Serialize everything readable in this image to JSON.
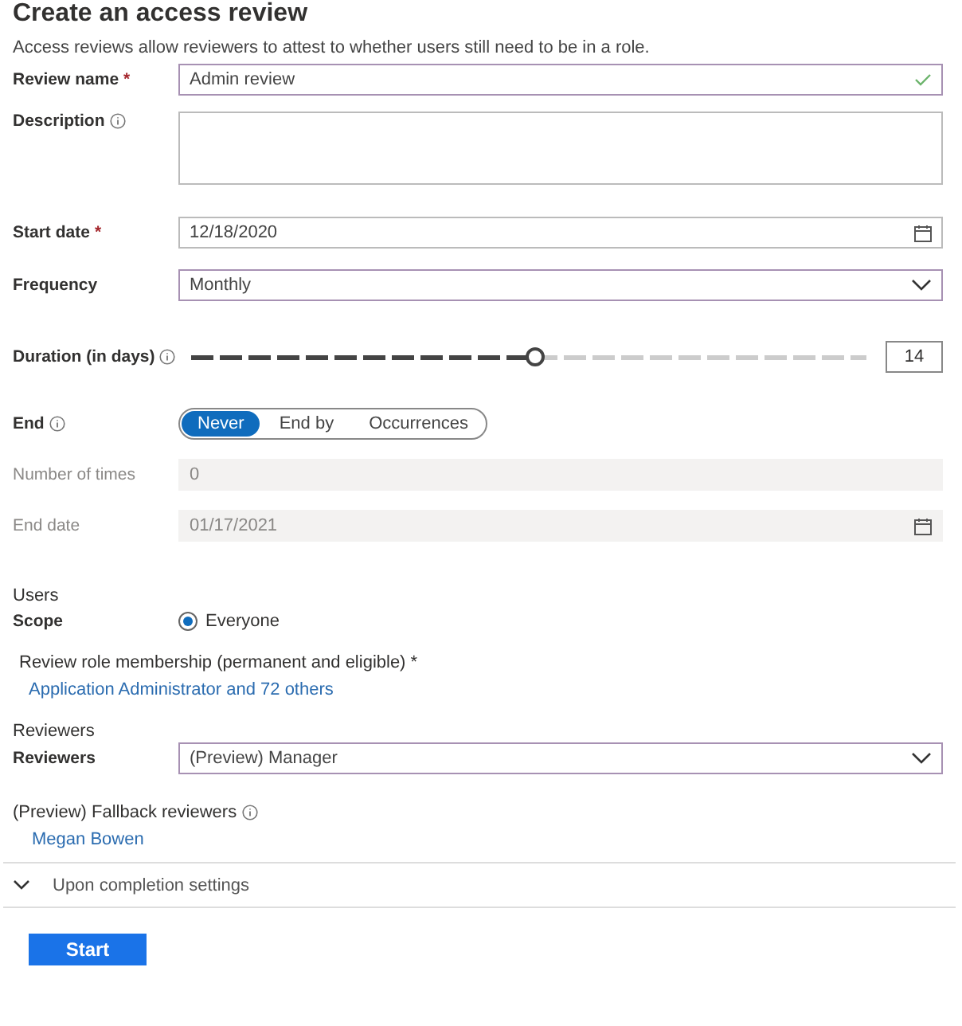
{
  "title": "Create an access review",
  "description": "Access reviews allow reviewers to attest to whether users still need to be in a role.",
  "fields": [
    {
      "kind": "text",
      "label": "Review name",
      "required_mark": "*",
      "info": false,
      "value": "Admin review",
      "valid": true,
      "disabled": false
    },
    {
      "kind": "textarea",
      "label": "Description",
      "info": true,
      "disabled": false
    },
    {
      "kind": "date",
      "label": "Start date",
      "required_mark": "*",
      "info": false,
      "value": "12/18/2020",
      "disabled": false
    },
    {
      "kind": "select",
      "label": "Frequency",
      "info": false,
      "value": "Monthly",
      "disabled": false
    },
    {
      "kind": "slider",
      "label": "Duration (in days)",
      "info": true,
      "level": 0.51,
      "value": "14",
      "disabled": false
    },
    {
      "kind": "segmented",
      "label": "End",
      "info": true,
      "options": [
        {
          "label": "Never",
          "selected": true
        },
        {
          "label": "End by",
          "selected": false
        },
        {
          "label": "Occurrences",
          "selected": false
        }
      ],
      "disabled": false
    },
    {
      "kind": "text",
      "label": "Number of times",
      "info": false,
      "value": "0",
      "valid": false,
      "disabled": true
    },
    {
      "kind": "date",
      "label": "End date",
      "info": false,
      "value": "01/17/2021",
      "disabled": true
    }
  ],
  "users": {
    "heading": "Users",
    "scope_label": "Scope",
    "scope_option": {
      "label": "Everyone",
      "selected": true
    },
    "membership_label": "Review role membership (permanent and eligible) *",
    "membership_link": "Application Administrator and 72 others"
  },
  "reviewers": {
    "heading": "Reviewers",
    "label": "Reviewers",
    "value": "(Preview) Manager",
    "fallback_label": "(Preview) Fallback reviewers",
    "fallback_link": "Megan Bowen"
  },
  "completion": {
    "label": "Upon completion settings",
    "expanded": false
  },
  "submit": "Start"
}
